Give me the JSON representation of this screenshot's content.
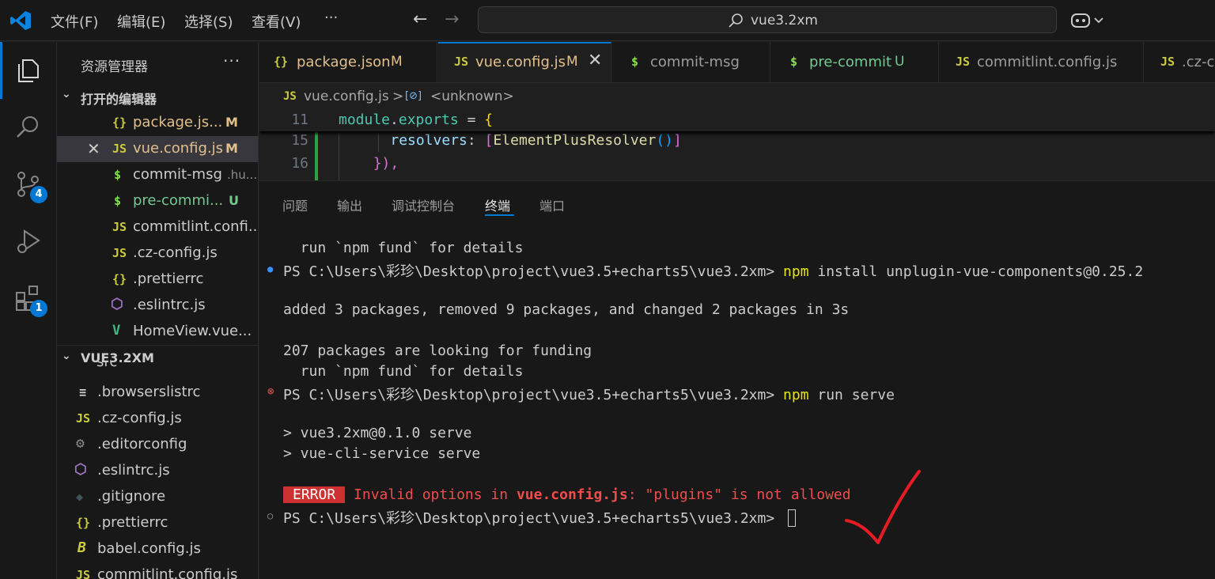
{
  "titlebar": {
    "menu": [
      "文件(F)",
      "编辑(E)",
      "选择(S)",
      "查看(V)",
      "···"
    ],
    "search_text": "vue3.2xm"
  },
  "activitybar": {
    "items": [
      {
        "icon": "explorer-icon",
        "active": true
      },
      {
        "icon": "search-icon"
      },
      {
        "icon": "source-control-icon",
        "badge": "4"
      },
      {
        "icon": "run-debug-icon"
      },
      {
        "icon": "extensions-icon",
        "badge": "1"
      }
    ]
  },
  "sidebar": {
    "title": "资源管理器",
    "more": "···",
    "open_editors": {
      "label": "打开的编辑器",
      "items": [
        {
          "icon": "{}",
          "icon_color": "#cbcb41",
          "name": "package.js...",
          "name_color": "#e2c08d",
          "mark": "M",
          "mark_color": "#e2c08d"
        },
        {
          "close": "✕",
          "icon": "JS",
          "icon_color": "#cbcb41",
          "name": "vue.config.js",
          "name_color": "#e2c08d",
          "mark": "M",
          "mark_color": "#e2c08d",
          "selected": true
        },
        {
          "icon": "$",
          "icon_color": "#89e051",
          "name": "commit-msg",
          "name_color": "#cccccc",
          "desc": ".hu..."
        },
        {
          "icon": "$",
          "icon_color": "#89e051",
          "name": "pre-commi...",
          "name_color": "#73c991",
          "mark": "U",
          "mark_color": "#73c991"
        },
        {
          "icon": "JS",
          "icon_color": "#cbcb41",
          "name": "commitlint.confi...",
          "name_color": "#cccccc"
        },
        {
          "icon": "JS",
          "icon_color": "#cbcb41",
          "name": ".cz-config.js",
          "name_color": "#cccccc"
        },
        {
          "icon": "{}",
          "icon_color": "#cbcb41",
          "name": ".prettierrc",
          "name_color": "#cccccc"
        },
        {
          "icon": "⬡",
          "icon_color": "#a074c4",
          "name": ".eslintrc.js",
          "name_color": "#cccccc"
        },
        {
          "icon": "V",
          "icon_color": "#41b883",
          "name": "HomeView.vue...",
          "name_color": "#cccccc"
        }
      ]
    },
    "project": {
      "label": "VUE3.2XM",
      "partial": "src",
      "items": [
        {
          "icon": "≡",
          "icon_color": "#cccccc",
          "name": ".browserslistrc"
        },
        {
          "icon": "JS",
          "icon_color": "#cbcb41",
          "name": ".cz-config.js"
        },
        {
          "icon": "⚙",
          "icon_color": "#8c8c8c",
          "name": ".editorconfig"
        },
        {
          "icon": "⬡",
          "icon_color": "#a074c4",
          "name": ".eslintrc.js"
        },
        {
          "icon": "◆",
          "icon_color": "#41535b",
          "name": ".gitignore"
        },
        {
          "icon": "{}",
          "icon_color": "#cbcb41",
          "name": ".prettierrc"
        },
        {
          "icon": "B",
          "icon_color": "#cbcb41",
          "name": "babel.config.js"
        },
        {
          "icon": "JS",
          "icon_color": "#cbcb41",
          "name": "commitlint.config.js"
        }
      ]
    }
  },
  "tabs": [
    {
      "icon": "{}",
      "icon_color": "#cbcb41",
      "name": "package.json",
      "name_color": "#e2c08d",
      "mark": "M",
      "mark_color": "#e2c08d"
    },
    {
      "icon": "JS",
      "icon_color": "#cbcb41",
      "name": "vue.config.js",
      "name_color": "#e2c08d",
      "mark": "M",
      "mark_color": "#e2c08d",
      "active": true,
      "close": "✕"
    },
    {
      "icon": "$",
      "icon_color": "#89e051",
      "name": "commit-msg",
      "name_color": "#9d9d9d"
    },
    {
      "icon": "$",
      "icon_color": "#89e051",
      "name": "pre-commit",
      "name_color": "#73c991",
      "mark": "U",
      "mark_color": "#73c991"
    },
    {
      "icon": "JS",
      "icon_color": "#cbcb41",
      "name": "commitlint.config.js",
      "name_color": "#9d9d9d"
    },
    {
      "icon": "JS",
      "icon_color": "#cbcb41",
      "name": ".cz-co",
      "name_color": "#9d9d9d"
    }
  ],
  "breadcrumb": {
    "icon": "JS",
    "file": "vue.config.js",
    "sep": ">",
    "symbol_icon": "[⊘]",
    "symbol": "<unknown>"
  },
  "code": {
    "sticky": {
      "ln": "11",
      "kw": "module",
      "rest1": ".",
      "prop": "exports",
      "rest2": " = ",
      "brace": "{"
    },
    "lines": [
      {
        "ln": "15",
        "indent": "    ",
        "key": "resolvers",
        "colon": ": ",
        "b1": "[",
        "fn": "ElementPlusResolver",
        "paren": "()",
        "b2": "]"
      },
      {
        "ln": "16",
        "indent": "  ",
        "close": "}),"
      }
    ]
  },
  "panel": {
    "tabs": [
      "问题",
      "输出",
      "调试控制台",
      "终端",
      "端口"
    ],
    "active_tab": "终端",
    "terminal": {
      "l1": "  run `npm fund` for details",
      "prompt": "PS C:\\Users\\彩珍\\Desktop\\project\\vue3.5+echarts5\\vue3.2xm> ",
      "cmd1_a": "npm",
      "cmd1_b": " install unplugin-vue-components@0.25.2",
      "l3": "added 3 packages, removed 9 packages, and changed 2 packages in 3s",
      "l4": "207 packages are looking for funding",
      "l5": "  run `npm fund` for details",
      "cmd2_a": "npm",
      "cmd2_b": " run serve",
      "l7": "> vue3.2xm@0.1.0 serve",
      "l8": "> vue-cli-service serve",
      "error_badge": "ERROR",
      "error_a": " Invalid options in ",
      "error_file": "vue.config.js",
      "error_b": ": \"plugins\" is not allowed"
    }
  },
  "colors": {
    "accent": "#0078d4",
    "error": "#f14c4c",
    "check": "#e51c23"
  }
}
